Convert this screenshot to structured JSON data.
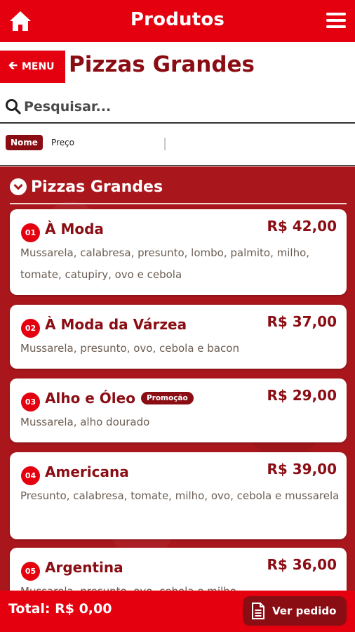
{
  "appbar": {
    "title": "Produtos",
    "home_icon": "home-icon",
    "menu_icon": "hamburger-menu-icon"
  },
  "header": {
    "menu_label": "MENU",
    "page_title": "Pizzas Grandes"
  },
  "search": {
    "placeholder": "Pesquisar...",
    "value": ""
  },
  "sort": {
    "active": "Nome",
    "options": [
      "Nome",
      "Preço"
    ]
  },
  "section": {
    "title": "Pizzas Grandes"
  },
  "products": [
    {
      "number": "01",
      "name": "À Moda",
      "price": "R$ 42,00",
      "description": "Mussarela, calabresa, presunto, lombo, palmito, milho, tomate, catupiry, ovo e cebola",
      "badge": ""
    },
    {
      "number": "02",
      "name": "À Moda da Várzea",
      "price": "R$ 37,00",
      "description": "Mussarela, presunto, ovo, cebola e bacon",
      "badge": ""
    },
    {
      "number": "03",
      "name": "Alho e Óleo",
      "price": "R$ 29,00",
      "description": "Mussarela, alho dourado",
      "badge": "Promoção"
    },
    {
      "number": "04",
      "name": "Americana",
      "price": "R$ 39,00",
      "description": "Presunto, calabresa, tomate, milho, ovo, cebola e mussarela",
      "badge": ""
    },
    {
      "number": "05",
      "name": "Argentina",
      "price": "R$ 36,00",
      "description": "Mussarela, presunto, ovo, cebola e milho",
      "badge": ""
    }
  ],
  "footer": {
    "total": "Total: R$ 0,00",
    "order_button": "Ver pedido"
  },
  "colors": {
    "primary_red": "#e4000f",
    "dark_red": "#8b0d14",
    "background_red": "#a9171c"
  }
}
